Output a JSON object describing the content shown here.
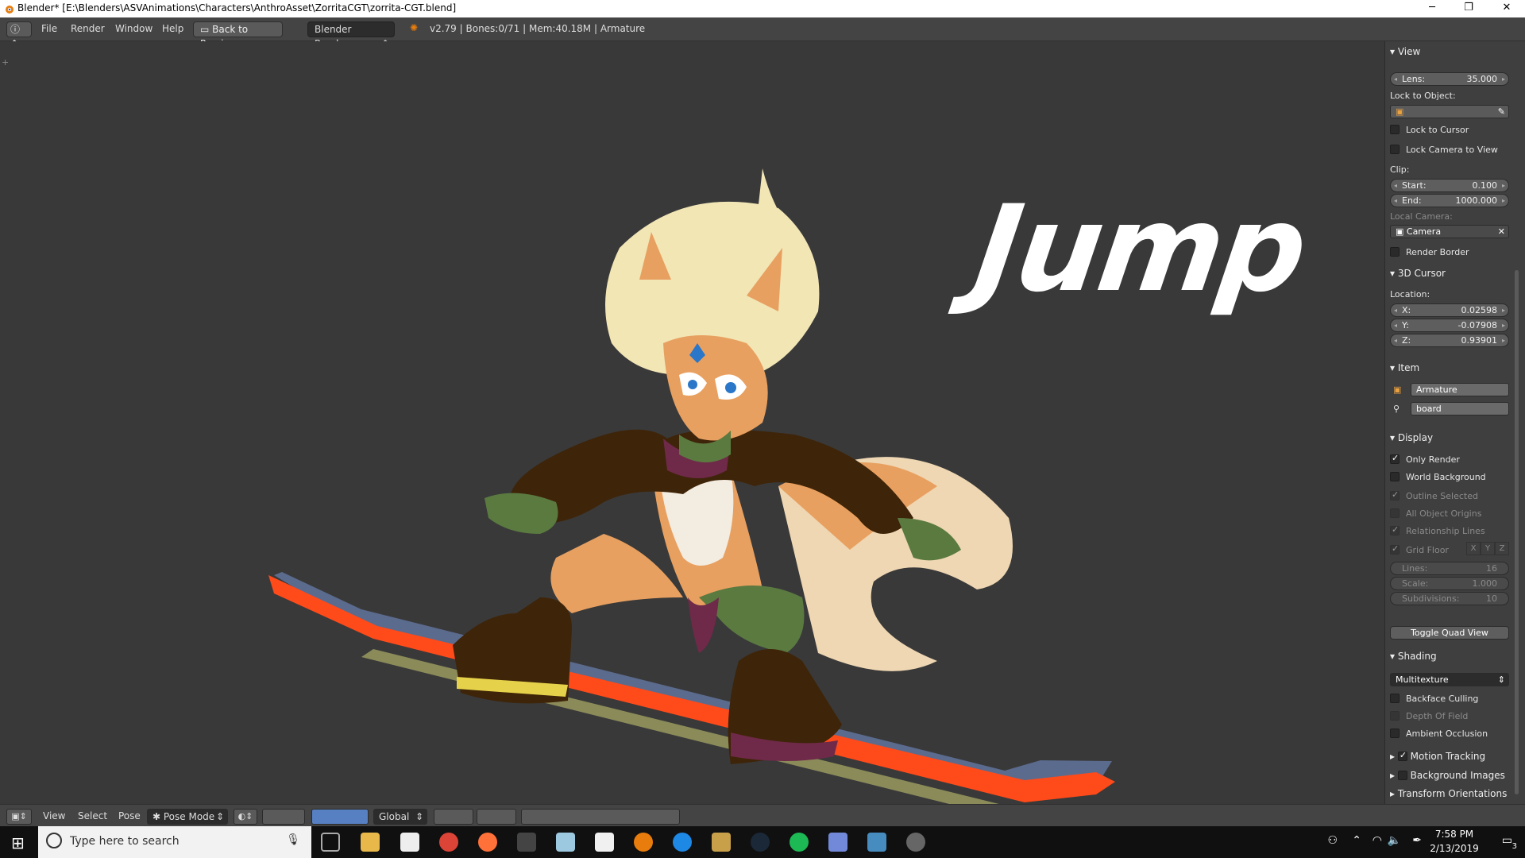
{
  "window": {
    "title": "Blender* [E:\\Blenders\\ASVAnimations\\Characters\\AnthroAsset\\ZorritaCGT\\zorrita-CGT.blend]",
    "minimize": "─",
    "maximize": "❐",
    "close": "✕"
  },
  "topbar": {
    "menus": [
      "File",
      "Render",
      "Window",
      "Help"
    ],
    "back_button": "Back to Previous",
    "engine": "Blender Render",
    "info": "v2.79 | Bones:0/71 | Mem:40.18M | Armature"
  },
  "viewport": {
    "overlay_text": "Jump"
  },
  "npanel": {
    "view": {
      "header": "View",
      "lens_label": "Lens:",
      "lens_value": "35.000",
      "lock_object_label": "Lock to Object:",
      "lock_cursor": "Lock to Cursor",
      "lock_camera": "Lock Camera to View",
      "clip_label": "Clip:",
      "clip_start_label": "Start:",
      "clip_start": "0.100",
      "clip_end_label": "End:",
      "clip_end": "1000.000",
      "local_camera_label": "Local Camera:",
      "local_camera": "Camera",
      "render_border": "Render Border"
    },
    "cursor": {
      "header": "3D Cursor",
      "location_label": "Location:",
      "x_label": "X:",
      "x": "0.02598",
      "y_label": "Y:",
      "y": "-0.07908",
      "z_label": "Z:",
      "z": "0.93901"
    },
    "item": {
      "header": "Item",
      "object": "Armature",
      "bone": "board"
    },
    "display": {
      "header": "Display",
      "only_render": "Only Render",
      "world_background": "World Background",
      "outline_selected": "Outline Selected",
      "all_object_origins": "All Object Origins",
      "relationship_lines": "Relationship Lines",
      "grid_floor": "Grid Floor",
      "axes": [
        "X",
        "Y",
        "Z"
      ],
      "lines_label": "Lines:",
      "lines": "16",
      "scale_label": "Scale:",
      "scale": "1.000",
      "subdivisions_label": "Subdivisions:",
      "subdivisions": "10",
      "toggle_quad": "Toggle Quad View"
    },
    "shading": {
      "header": "Shading",
      "mode": "Multitexture",
      "backface_culling": "Backface Culling",
      "depth_of_field": "Depth Of Field",
      "ambient_occlusion": "Ambient Occlusion"
    },
    "collapsed": [
      "Motion Tracking",
      "Background Images",
      "Transform Orientations"
    ]
  },
  "bottombar": {
    "menus": [
      "View",
      "Select",
      "Pose"
    ],
    "mode": "Pose Mode",
    "orientation": "Global"
  },
  "taskbar": {
    "search_placeholder": "Type here to search",
    "time": "7:58 PM",
    "date": "2/13/2019",
    "notifications": "3"
  },
  "colors": {
    "board_orange": "#ff4a1a",
    "hair": "#f2e6b5",
    "fur": "#e8a060",
    "jacket": "#3e2408",
    "glove": "#5a7a40",
    "maroon": "#6e2a48"
  }
}
